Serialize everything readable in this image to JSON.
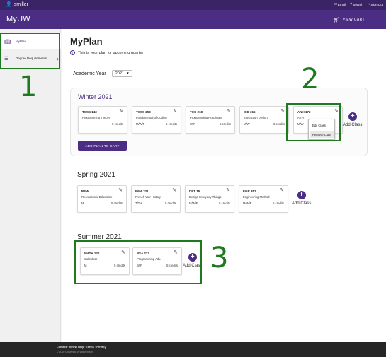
{
  "topbar": {
    "username": "smiller",
    "links": [
      "Email",
      "Search",
      "Sign Out"
    ]
  },
  "navbar": {
    "brand": "MyUW",
    "cart_label": "VIEW CART"
  },
  "sidebar": {
    "items": [
      {
        "label": "MyPlan",
        "icon": "book-icon",
        "active": true
      },
      {
        "label": "Degree Requirements",
        "icon": "list-icon",
        "active": false
      }
    ]
  },
  "main": {
    "title": "MyPlan",
    "subtitle": "This is your plan for upcoming quarter",
    "year_label": "Academic Year",
    "year_value": "2021",
    "add_plan_button": "ADD PLAN TO CART",
    "add_class_label": "Add Class"
  },
  "terms": [
    {
      "name": "Winter 2021",
      "classes": [
        {
          "code": "TCSS 143",
          "name": "Programming Theory",
          "days": "",
          "credits": "5 credits"
        },
        {
          "code": "TCSS 253",
          "name": "Fundamental of Coding",
          "days": "M/W/F",
          "credits": "5 credits"
        },
        {
          "code": "TCC 218",
          "name": "Programming Practicum",
          "days": "W/F",
          "credits": "5 credits"
        },
        {
          "code": "IDD 365",
          "name": "Interaction Design",
          "days": "M/W",
          "credits": "5 credits"
        },
        {
          "code": "ANH 172",
          "name": "Art A",
          "days": "M/W",
          "credits": ""
        }
      ]
    },
    {
      "name": "Spring 2021",
      "classes": [
        {
          "code": "REW",
          "name": "Recreational Education",
          "days": "M",
          "credits": "5 credits"
        },
        {
          "code": "FWA 321",
          "name": "French War History",
          "days": "T/TH",
          "credits": "5 credits"
        },
        {
          "code": "DET 15",
          "name": "Design Everyday Things",
          "days": "M/W/F",
          "credits": "5 credits"
        },
        {
          "code": "EGR 352",
          "name": "Engineering Method",
          "days": "M/W/F",
          "credits": "5 credits"
        }
      ]
    },
    {
      "name": "Summer 2021",
      "classes": [
        {
          "code": "MATH 140",
          "name": "Calculus I",
          "days": "M",
          "credits": "5 credits"
        },
        {
          "code": "PSA 222",
          "name": "Programming Adv.",
          "days": "W/F",
          "credits": "5 credits"
        }
      ]
    }
  ],
  "context_menu": {
    "items": [
      "Edit Class",
      "Remove Class"
    ]
  },
  "annotations": [
    "1",
    "2",
    "3"
  ],
  "footer": {
    "links": "Contact · MyUW Help · Terms · Privacy",
    "copyright": "© 2020 University of Washington"
  },
  "colors": {
    "brand_purple": "#4b2e83",
    "annotation_green": "#1f7a1f"
  }
}
